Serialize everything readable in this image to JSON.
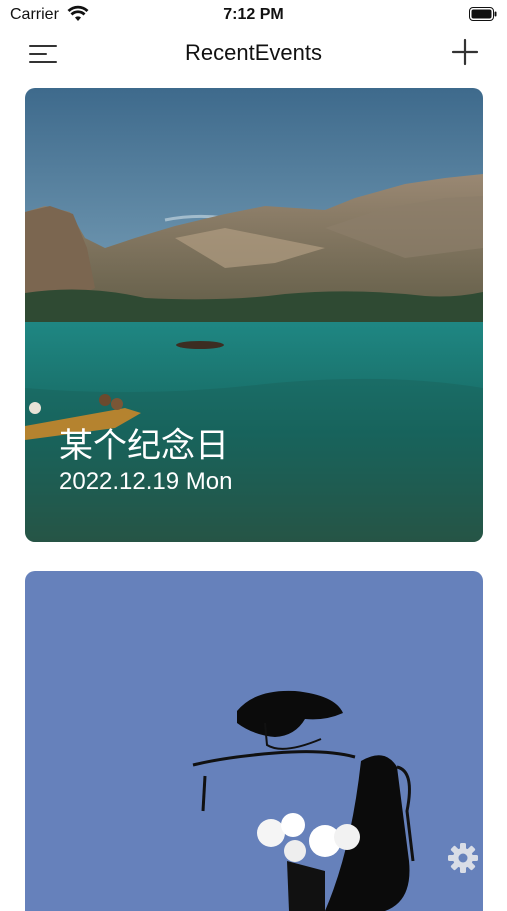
{
  "status_bar": {
    "carrier": "Carrier",
    "time": "7:12 PM"
  },
  "nav": {
    "title": "RecentEvents"
  },
  "events": [
    {
      "title": "某个纪念日",
      "date": "2022.12.19 Mon"
    },
    {
      "title": "",
      "date": ""
    }
  ],
  "icons": [
    "menu-icon",
    "plus-icon",
    "gear-icon",
    "wifi-icon",
    "battery-icon"
  ],
  "colors": {
    "card2_bg": "#6681bb",
    "lake": "#1f6e6a",
    "sky": "#5d87a6"
  }
}
